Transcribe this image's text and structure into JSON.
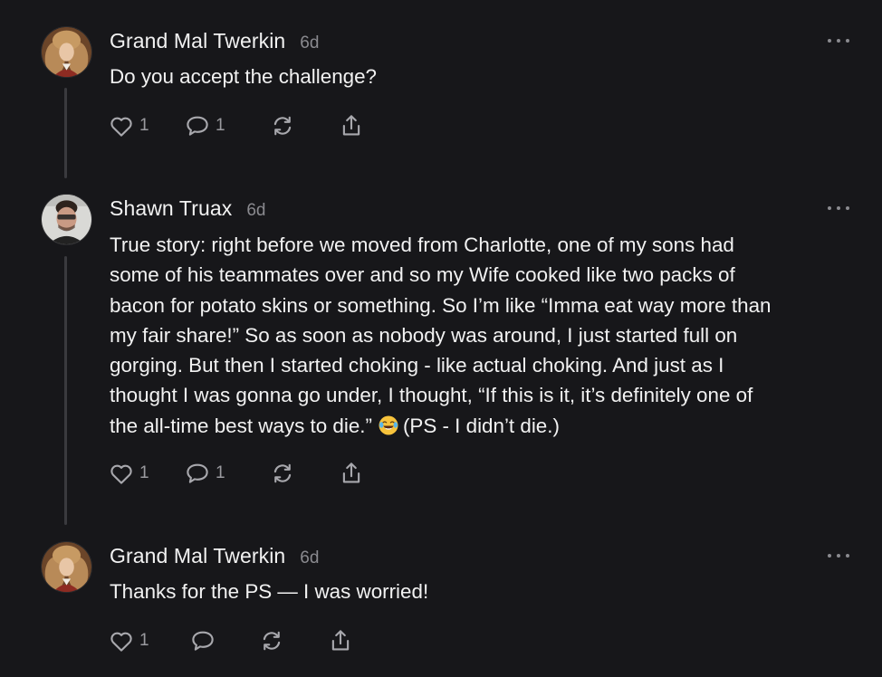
{
  "posts": [
    {
      "author": "Grand Mal Twerkin",
      "time": "6d",
      "text": "Do you accept the challenge?",
      "like_count": "1",
      "comment_count": "1"
    },
    {
      "author": "Shawn Truax",
      "time": "6d",
      "text_before_emoji": "True story: right before we moved from Charlotte, one of my sons had\nsome of his teammates over and so my Wife cooked like two packs of\nbacon for potato skins or something. So I’m like “Imma eat way more than\nmy fair share!” So as soon as nobody was around, I just started full on\ngorging. But then I started choking - like actual choking. And just as I\nthought I was gonna go under, I thought, “If this is it, it’s definitely one of\nthe all-time best ways to die.”",
      "emoji": "face-with-tears-of-joy",
      "text_after_emoji": "(PS - I didn’t die.)",
      "like_count": "1",
      "comment_count": "1"
    },
    {
      "author": "Grand Mal Twerkin",
      "time": "6d",
      "text": "Thanks for the PS — I was worried!",
      "like_count": "1",
      "comment_count": ""
    }
  ],
  "icons": {
    "like": "heart-icon",
    "comment": "comment-icon",
    "restack": "restack-icon",
    "share": "share-icon",
    "more": "more-options-icon"
  },
  "colors": {
    "background": "#17171a",
    "text": "#f2f2f2",
    "muted": "#8a8a8f",
    "thread_line": "#3a3a3e"
  }
}
